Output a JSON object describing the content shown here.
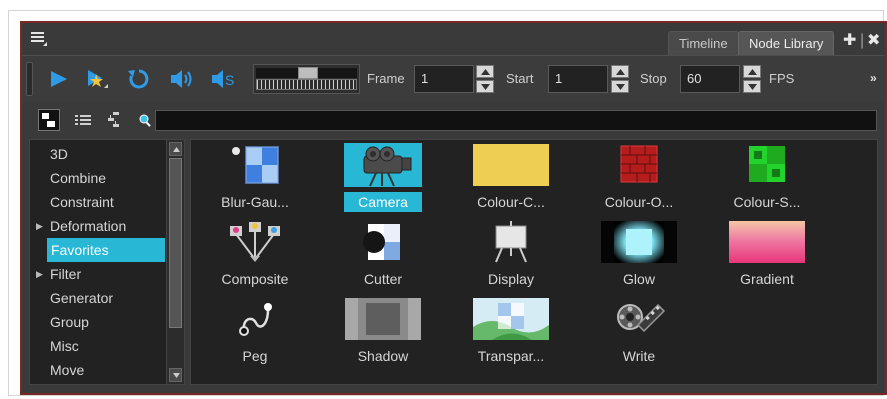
{
  "tabs": {
    "timeline": "Timeline",
    "node_library": "Node Library"
  },
  "toolbar": {
    "frame_label": "Frame",
    "frame_value": "1",
    "start_label": "Start",
    "start_value": "1",
    "stop_label": "Stop",
    "stop_value": "60",
    "fps_label": "FPS",
    "more": "»"
  },
  "search": {
    "value": ""
  },
  "categories": [
    {
      "label": "3D",
      "expandable": false,
      "selected": false
    },
    {
      "label": "Combine",
      "expandable": false,
      "selected": false
    },
    {
      "label": "Constraint",
      "expandable": false,
      "selected": false
    },
    {
      "label": "Deformation",
      "expandable": true,
      "selected": false
    },
    {
      "label": "Favorites",
      "expandable": false,
      "selected": true
    },
    {
      "label": "Filter",
      "expandable": true,
      "selected": false
    },
    {
      "label": "Generator",
      "expandable": false,
      "selected": false
    },
    {
      "label": "Group",
      "expandable": false,
      "selected": false
    },
    {
      "label": "Misc",
      "expandable": false,
      "selected": false
    },
    {
      "label": "Move",
      "expandable": false,
      "selected": false
    }
  ],
  "nodes": [
    {
      "label": "Blur-Gau...",
      "icon": "blur-gaussian-icon",
      "selected": false
    },
    {
      "label": "Camera",
      "icon": "camera-icon",
      "selected": true
    },
    {
      "label": "Colour-C...",
      "icon": "colour-card-icon",
      "selected": false
    },
    {
      "label": "Colour-O...",
      "icon": "colour-override-icon",
      "selected": false
    },
    {
      "label": "Colour-S...",
      "icon": "colour-screen-icon",
      "selected": false
    },
    {
      "label": "Composite",
      "icon": "composite-icon",
      "selected": false
    },
    {
      "label": "Cutter",
      "icon": "cutter-icon",
      "selected": false
    },
    {
      "label": "Display",
      "icon": "display-icon",
      "selected": false
    },
    {
      "label": "Glow",
      "icon": "glow-icon",
      "selected": false
    },
    {
      "label": "Gradient",
      "icon": "gradient-icon",
      "selected": false
    },
    {
      "label": "Peg",
      "icon": "peg-icon",
      "selected": false
    },
    {
      "label": "Shadow",
      "icon": "shadow-icon",
      "selected": false
    },
    {
      "label": "Transpar...",
      "icon": "transparency-icon",
      "selected": false
    },
    {
      "label": "Write",
      "icon": "write-icon",
      "selected": false
    }
  ],
  "colors": {
    "accent": "#29b7d6",
    "panel_border": "#7a2727",
    "play_blue": "#2f9ae6"
  }
}
